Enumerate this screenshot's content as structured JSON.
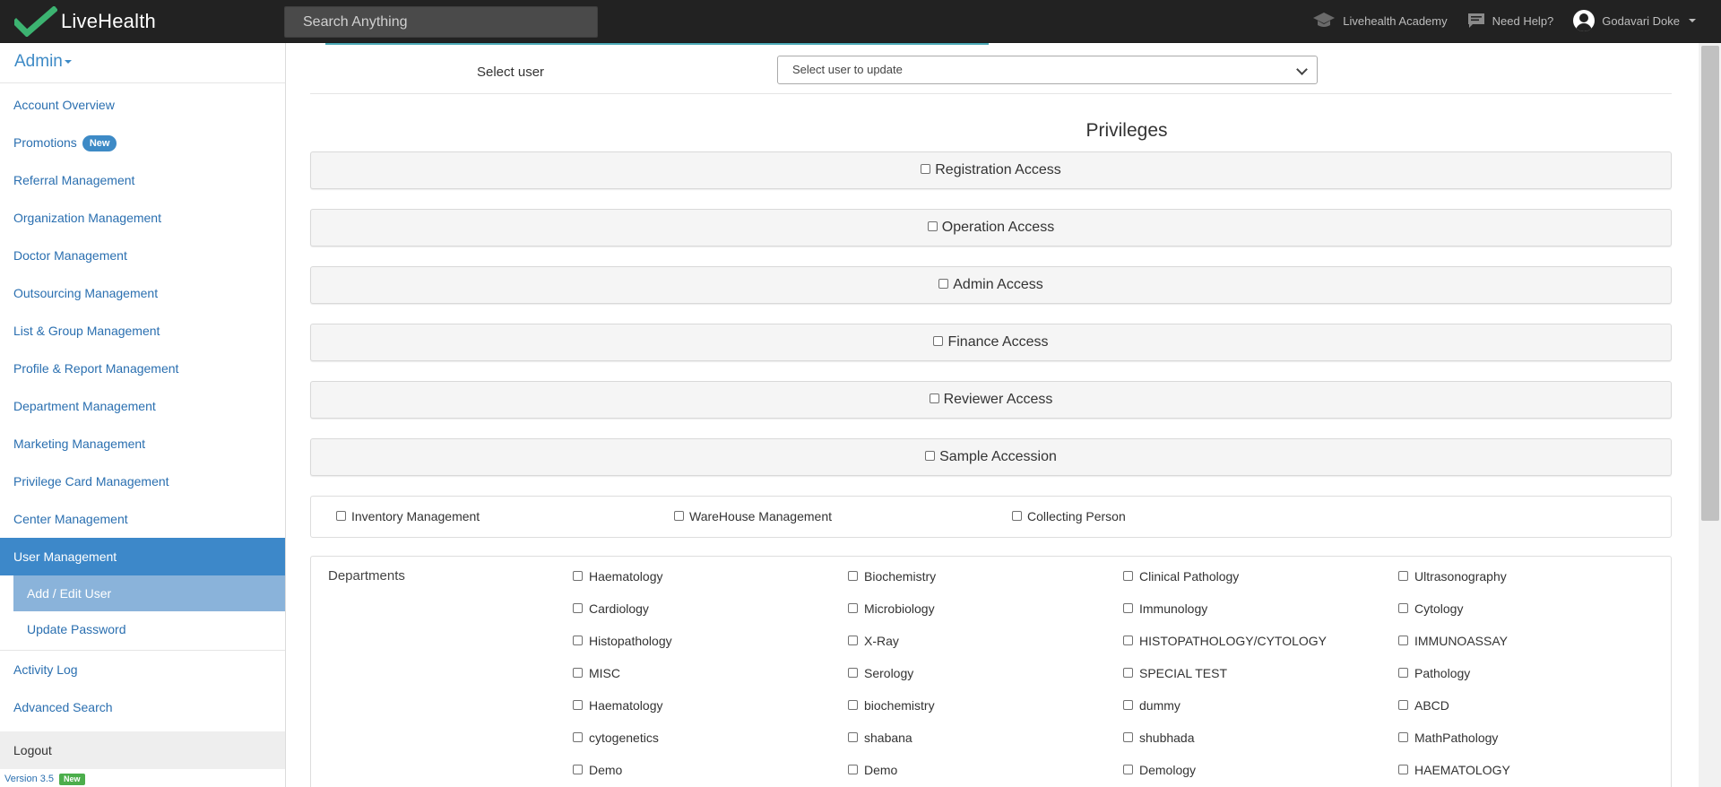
{
  "topbar": {
    "brand": "LiveHealth",
    "search_placeholder": "Search Anything",
    "academy": "Livehealth Academy",
    "help": "Need Help?",
    "user": "Godavari Doke"
  },
  "sidebar": {
    "title": "Admin",
    "items": [
      {
        "label": "Account Overview"
      },
      {
        "label": "Promotions",
        "badge": "New"
      },
      {
        "label": "Referral Management"
      },
      {
        "label": "Organization Management"
      },
      {
        "label": "Doctor Management"
      },
      {
        "label": "Outsourcing Management"
      },
      {
        "label": "List & Group Management"
      },
      {
        "label": "Profile & Report Management"
      },
      {
        "label": "Department Management"
      },
      {
        "label": "Marketing Management"
      },
      {
        "label": "Privilege Card Management"
      },
      {
        "label": "Center Management"
      }
    ],
    "active_item": "User Management",
    "sub_items": [
      {
        "label": "Add / Edit User"
      },
      {
        "label": "Update Password"
      }
    ],
    "after_items": [
      {
        "label": "Activity Log"
      },
      {
        "label": "Advanced Search"
      }
    ],
    "logout": "Logout",
    "version": "Version 3.5",
    "version_badge": "New"
  },
  "main": {
    "select_label": "Select user",
    "select_placeholder": "Select user to update",
    "privileges_title": "Privileges",
    "privilege_panels": [
      "Registration Access",
      "Operation Access",
      "Admin Access",
      "Finance Access",
      "Reviewer Access",
      "Sample Accession"
    ],
    "extra_options": [
      "Inventory Management",
      "WareHouse Management",
      "Collecting Person"
    ],
    "departments_label": "Departments",
    "departments": [
      [
        "Haematology",
        "Biochemistry",
        "Clinical Pathology",
        "Ultrasonography"
      ],
      [
        "Cardiology",
        "Microbiology",
        "Immunology",
        "Cytology"
      ],
      [
        "Histopathology",
        "X-Ray",
        "HISTOPATHOLOGY/CYTOLOGY",
        "IMMUNOASSAY"
      ],
      [
        "MISC",
        "Serology",
        "SPECIAL TEST",
        "Pathology"
      ],
      [
        "Haematology",
        "biochemistry",
        "dummy",
        "ABCD"
      ],
      [
        "cytogenetics",
        "shabana",
        "shubhada",
        "MathPathology"
      ],
      [
        "Demo",
        "Demo",
        "Demology",
        "HAEMATOLOGY"
      ]
    ]
  },
  "colors": {
    "topbar_bg": "#222222",
    "brand_green": "#3cb371",
    "link_blue": "#2a6fb0",
    "active_bg": "#3d88c9",
    "sub_active_bg": "#8ab3da",
    "badge_new": "#3d8ac6"
  }
}
